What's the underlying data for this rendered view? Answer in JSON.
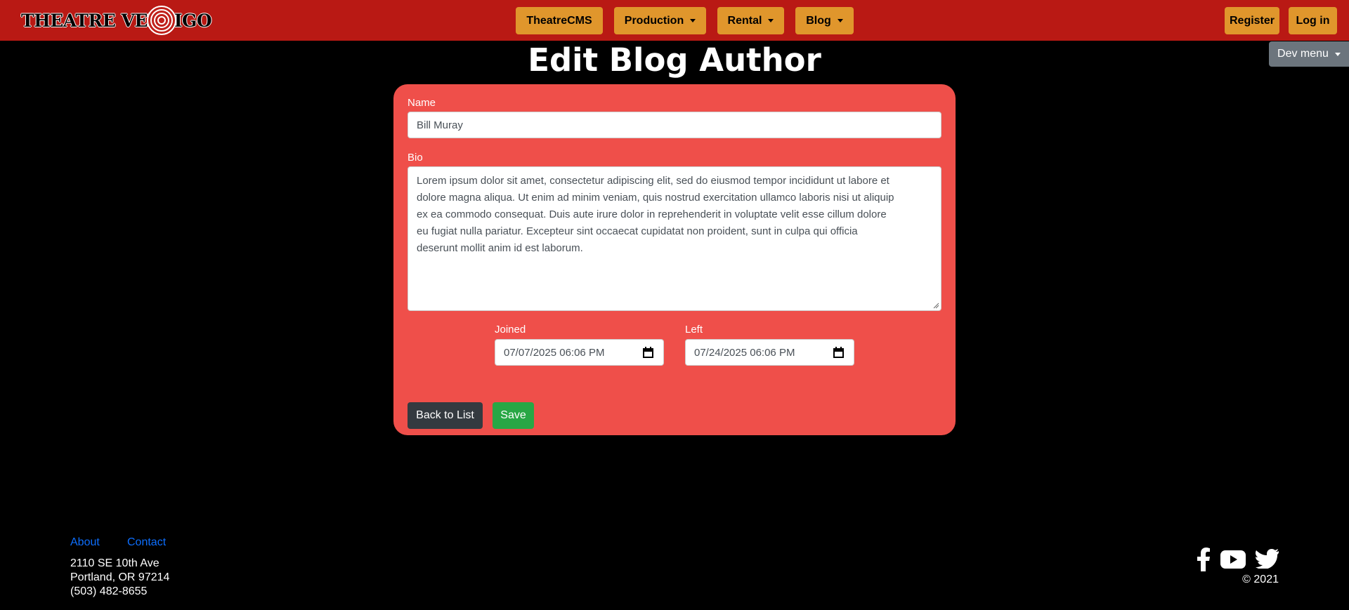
{
  "brand": {
    "name": "THEATRE VERTIGO",
    "icon": "swirl-logo-icon"
  },
  "nav": {
    "center": [
      {
        "label": "TheatreCMS",
        "dropdown": false
      },
      {
        "label": "Production",
        "dropdown": true
      },
      {
        "label": "Rental",
        "dropdown": true
      },
      {
        "label": "Blog",
        "dropdown": true
      }
    ],
    "register": "Register",
    "login": "Log in",
    "dev_menu": "Dev menu"
  },
  "page": {
    "title": "Edit Blog Author"
  },
  "form": {
    "name_label": "Name",
    "name_value": "Bill Muray",
    "bio_label": "Bio",
    "bio_value": "Lorem ipsum dolor sit amet, consectetur adipiscing elit, sed do eiusmod tempor incididunt ut labore et\ndolore magna aliqua. Ut enim ad minim veniam, quis nostrud exercitation ullamco laboris nisi ut aliquip\nex ea commodo consequat. Duis aute irure dolor in reprehenderit in voluptate velit esse cillum dolore\neu fugiat nulla pariatur. Excepteur sint occaecat cupidatat non proident, sunt in culpa qui officia\ndeserunt mollit anim id est laborum.",
    "joined_label": "Joined",
    "joined_value": "07/07/2025 06:06 PM",
    "left_label": "Left",
    "left_value": "07/24/2025 06:06 PM",
    "back_button": "Back to List",
    "save_button": "Save"
  },
  "footer": {
    "about": "About",
    "contact": "Contact",
    "address_line1": "2110 SE 10th Ave",
    "address_line2": "Portland, OR 97214",
    "phone": "(503) 482-8655",
    "copyright": "© 2021",
    "social_icons": [
      "facebook-icon",
      "youtube-icon",
      "twitter-icon"
    ]
  },
  "colors": {
    "navbar": "#b91914",
    "nav_button": "#e0962c",
    "card": "#ef4f4a",
    "back_button": "#343a40",
    "save_button": "#28a745",
    "dev_menu": "#6c757d",
    "link": "#0d6efd"
  }
}
